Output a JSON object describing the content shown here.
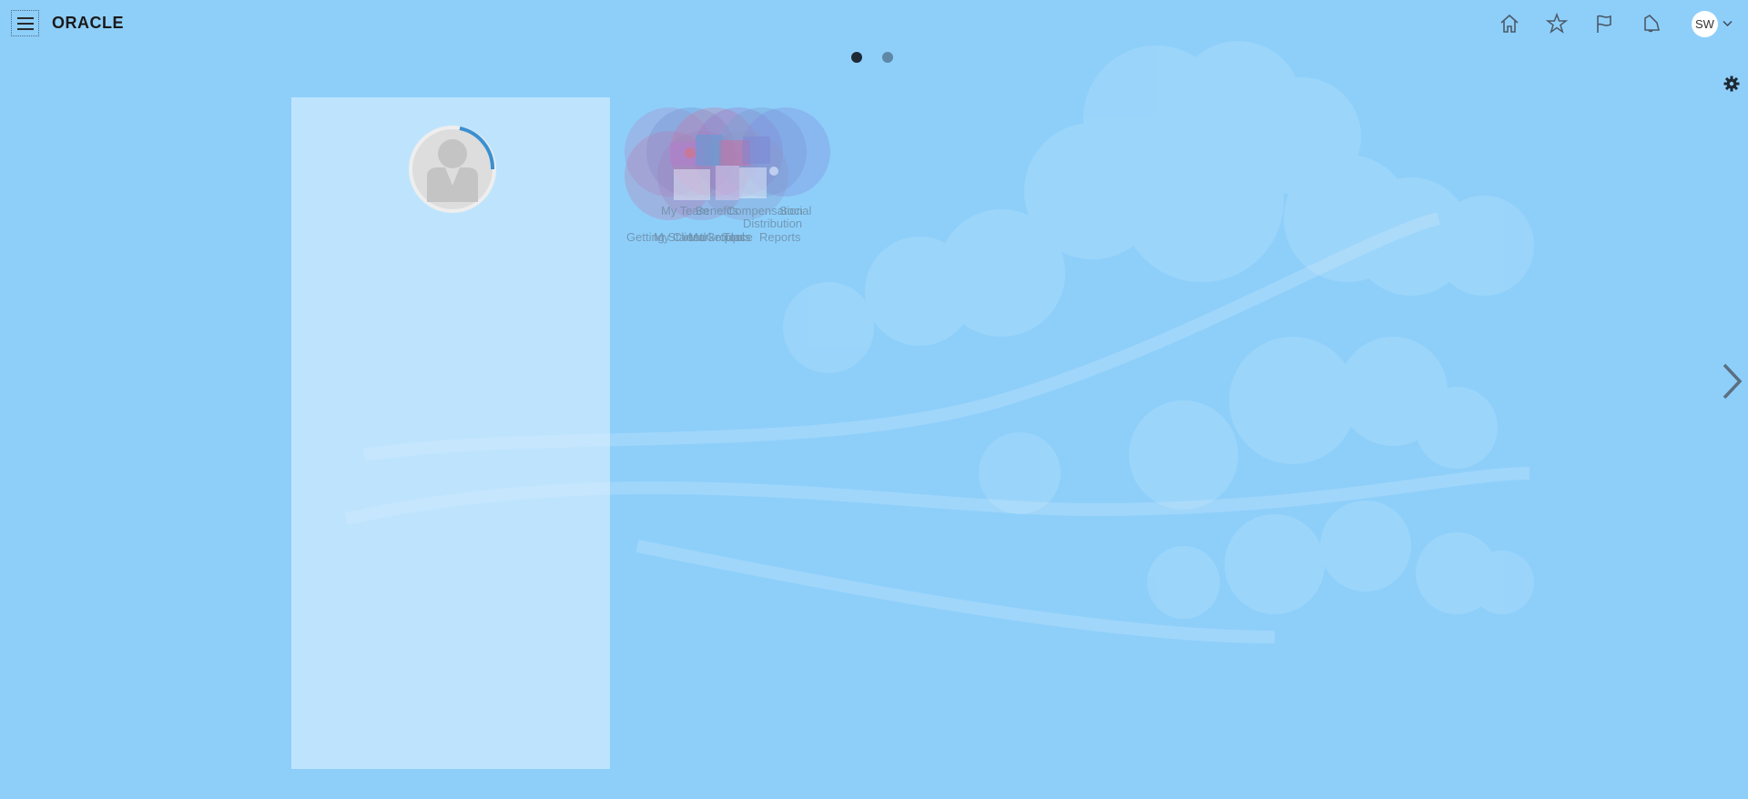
{
  "header": {
    "brand": "ORACLE",
    "menu_icon": "hamburger-icon",
    "actions": [
      {
        "name": "home-icon"
      },
      {
        "name": "star-icon"
      },
      {
        "name": "flag-icon"
      },
      {
        "name": "bell-icon"
      }
    ],
    "user_initials": "SW",
    "user_menu_icon": "chevron-down-icon"
  },
  "pagination": {
    "pages": 2,
    "current": 1
  },
  "colors": {
    "background": "#8ecffa",
    "panel": "#d4ecfd",
    "dot_active": "#1e2a35",
    "dot_inactive": "#5f87a6",
    "progress_arc": "#3a90d0"
  },
  "profile": {
    "icon": "user-avatar-icon",
    "progress_icon": "loading-arc-icon"
  },
  "springboard": {
    "tiles": [
      {
        "label": "Getting Started",
        "icon": "getting-started-icon"
      },
      {
        "label": "My Team",
        "icon": "my-team-icon"
      },
      {
        "label": "My Client Groups",
        "icon": "client-groups-icon"
      },
      {
        "label": "Benefits",
        "icon": "benefits-icon"
      },
      {
        "label": "Marketplace",
        "icon": "marketplace-icon"
      },
      {
        "label": "Compensation",
        "icon": "compensation-icon"
      },
      {
        "label": "Tools",
        "icon": "tools-icon"
      },
      {
        "label": "Social",
        "icon": "social-icon"
      },
      {
        "label": "Reports",
        "icon": "reports-icon"
      },
      {
        "label": "Distribution",
        "icon": "distribution-icon"
      }
    ]
  },
  "settings_icon": "gear-icon",
  "next_page_icon": "chevron-right-icon"
}
